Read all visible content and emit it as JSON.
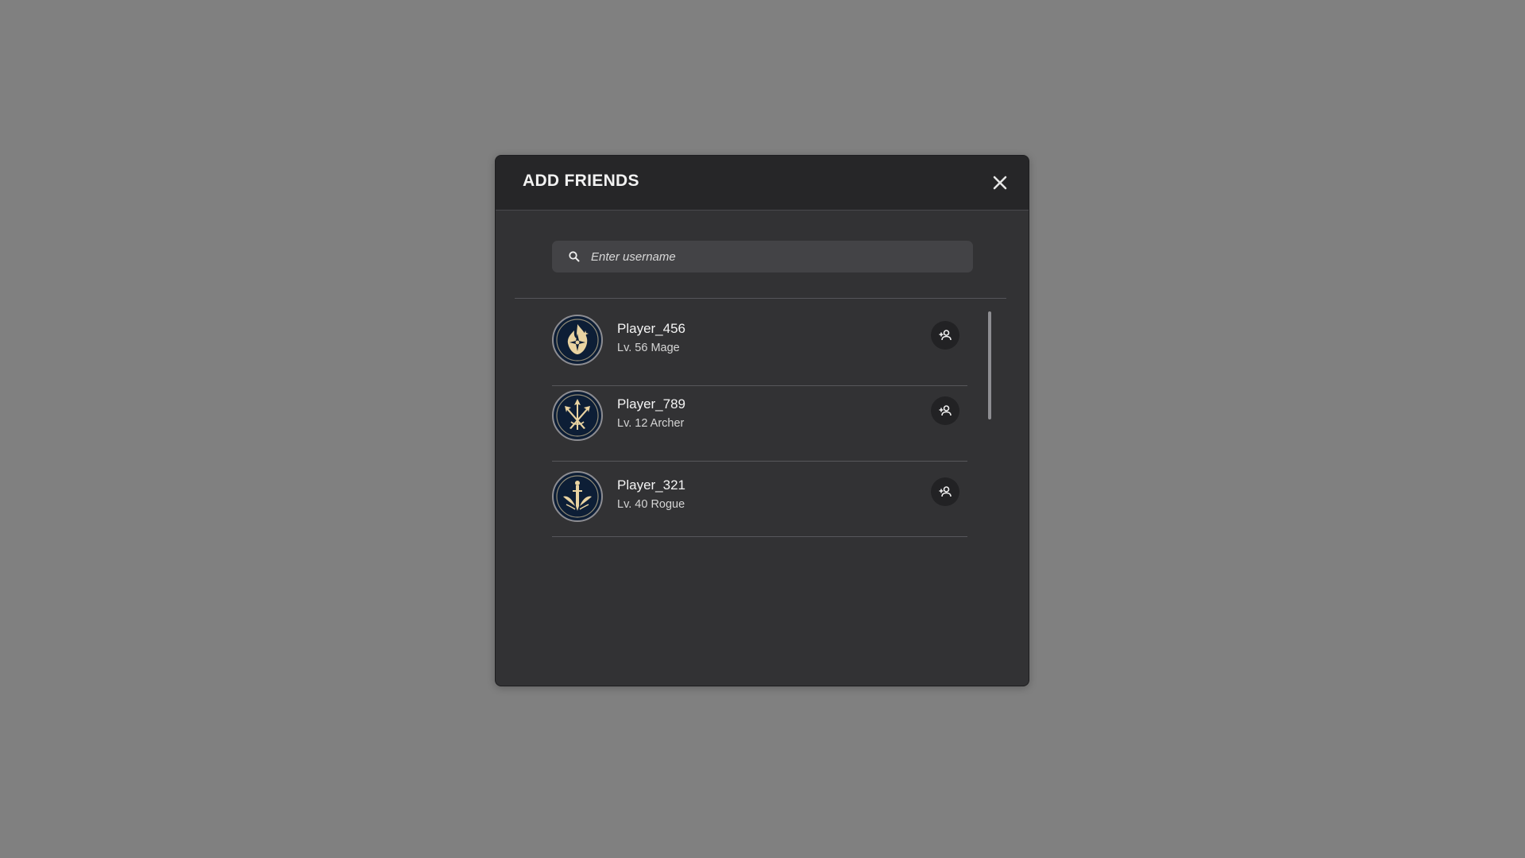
{
  "dialog": {
    "title": "ADD FRIENDS",
    "close_icon": "close-icon"
  },
  "search": {
    "placeholder": "Enter username",
    "value": "",
    "icon": "search-icon"
  },
  "players": [
    {
      "name": "Player_456",
      "subtitle": "Lv. 56 Mage",
      "avatar_icon": "mage-flame-emblem-icon",
      "action_icon": "add-friend-icon"
    },
    {
      "name": "Player_789",
      "subtitle": "Lv. 12 Archer",
      "avatar_icon": "archer-arrows-emblem-icon",
      "action_icon": "add-friend-icon"
    },
    {
      "name": "Player_321",
      "subtitle": "Lv. 40 Rogue",
      "avatar_icon": "rogue-dagger-emblem-icon",
      "action_icon": "add-friend-icon"
    }
  ],
  "colors": {
    "overlay": "#808080",
    "panel": "#323234",
    "header": "#262628",
    "avatar_bg": "#0d1e36",
    "emblem_gold": "#e9d3a1"
  }
}
